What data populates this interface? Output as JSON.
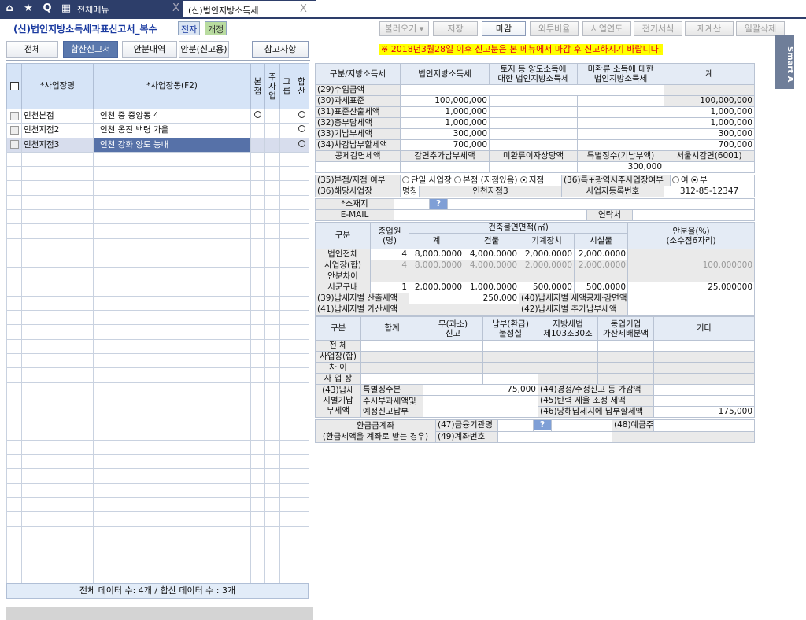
{
  "topbar": {
    "icons": [
      "home-icon",
      "star-icon",
      "search-icon",
      "calendar-icon"
    ],
    "q": "Q",
    "tabs": [
      {
        "label": "전체메뉴",
        "close": "X"
      },
      {
        "label": "(신)법인지방소득세",
        "close": "X"
      }
    ]
  },
  "header": {
    "title": "(신)법인지방소득세과표신고서_복수",
    "badge1": "전자",
    "badge2": "개정",
    "buttons": [
      "불러오기 ▾",
      "저장",
      "마감",
      "외투비율",
      "사업연도",
      "전기서식",
      "재계산",
      "일괄삭제"
    ]
  },
  "subtabs": [
    "전체",
    "합산신고서",
    "안분내역",
    "안분(신고용)"
  ],
  "ref_button": "참고사항",
  "notice": "※ 2018년3월28일 이후 신고분은 본 메뉴에서 마감 후 신고하시기 바랍니다.",
  "smart": "Smart A",
  "grid": {
    "headers": [
      "*사업장명",
      "*사업장동(F2)",
      "본점",
      "주사업",
      "그룹",
      "합산"
    ],
    "rows": [
      {
        "name": "인천본점",
        "dong": "인천  중  중앙동 4",
        "hq": "○",
        "main": "",
        "group": "",
        "sum": "○"
      },
      {
        "name": "인천지점2",
        "dong": "인천  옹진  백령  가을",
        "hq": "",
        "main": "",
        "group": "",
        "sum": "○"
      },
      {
        "name": "인천지점3",
        "dong": "인천  강화  양도  능내",
        "hq": "",
        "main": "",
        "group": "",
        "sum": "○"
      }
    ],
    "footer": "전체 데이터 수: 4개 / 합산 데이터 수 : 3개"
  },
  "tax": {
    "headers": [
      "구분/지방소득세",
      "법인지방소득세",
      "토지 등 양도소득에\n대한 법인지방소득세",
      "미환류 소득에 대한\n법인지방소득세",
      "계"
    ],
    "rows": [
      {
        "label": "(29)수입금액"
      },
      {
        "label": "(30)과세표준",
        "v": "100,000,000",
        "t": "100,000,000"
      },
      {
        "label": "(31)표준산출세액",
        "v": "1,000,000",
        "t": "1,000,000"
      },
      {
        "label": "(32)총부담세액",
        "v": "1,000,000",
        "t": "1,000,000"
      },
      {
        "label": "(33)기납부세액",
        "v": "300,000",
        "t": "300,000"
      },
      {
        "label": "(34)차감납부할세액",
        "v": "700,000",
        "t": "700,000"
      }
    ],
    "sub_headers": [
      "공제감면세액",
      "감면추가납부세액",
      "미환류이자상당액",
      "특별징수(기납부액)",
      "서울시감면(6001)"
    ],
    "special_withholding": "300,000"
  },
  "branch": {
    "label": "(35)본점/지점 여부",
    "options": [
      "단일 사업장",
      "본점 (지점있음)",
      "지점"
    ],
    "selected": "지점",
    "metro_label": "(36)특+광역시주사업장여부",
    "metro_options": [
      "여",
      "부"
    ],
    "metro_selected": "부",
    "site_label": "(36)해당사업장",
    "name_label": "명칭",
    "name": "인천지점3",
    "reg_label": "사업자등록번호",
    "reg": "312-85-12347",
    "addr_label": "*소재지",
    "q": "?",
    "email_label": "E-MAIL",
    "contact_label": "연락처"
  },
  "area": {
    "h_gubun": "구분",
    "h_emp": "종업원\n(명)",
    "h_area": "건축물연면적(㎡)",
    "h_cols": [
      "계",
      "건물",
      "기계장치",
      "시설물"
    ],
    "h_ratio": "안분율(%)\n(소수점6자리)",
    "rows": [
      {
        "label": "법인전체",
        "emp": "4",
        "vals": [
          "8,000.0000",
          "4,000.0000",
          "2,000.0000",
          "2,000.0000"
        ],
        "ratio": ""
      },
      {
        "label": "사업장(합)",
        "emp": "4",
        "vals": [
          "8,000.0000",
          "4,000.0000",
          "2,000.0000",
          "2,000.0000"
        ],
        "ratio": "100.000000"
      },
      {
        "label": "안분차이",
        "emp": "",
        "vals": [
          "",
          "",
          "",
          ""
        ],
        "ratio": ""
      },
      {
        "label": "시군구내",
        "emp": "1",
        "vals": [
          "2,000.0000",
          "1,000.0000",
          "500.0000",
          "500.0000"
        ],
        "ratio": "25.000000"
      }
    ],
    "l39": "(39)납세지별 산출세액",
    "v39": "250,000",
    "l40": "(40)납세지별 세액공제·감면액",
    "l41": "(41)납세지별 가산세액",
    "l42": "(42)납세지별 추가납부세액"
  },
  "penalty": {
    "headers": [
      "구분",
      "합계",
      "무(과소)\n신고",
      "납부(환급)\n불성실",
      "지방세법\n제103조30조",
      "동업기업\n가산세배분액",
      "기타"
    ],
    "rows": [
      "전   체",
      "사업장(합)",
      "차    이",
      "사 업 장"
    ],
    "l43": "(43)납세\n지별기납\n부세액",
    "special": "특별징수분",
    "special_v": "75,000",
    "occasional": "수시부과세액및\n예정신고납부",
    "l44": "(44)경정/수정신고 등 가감액",
    "l45": "(45)탄력 세율 조정 세액",
    "l46": "(46)당해납세지에 납부할세액",
    "v46": "175,000",
    "refund": "환급금계좌\n(환급세액을 계좌로 받는 경우)",
    "l47": "(47)금융기관명",
    "l48": "(48)예금주",
    "l49": "(49)계좌번호"
  }
}
